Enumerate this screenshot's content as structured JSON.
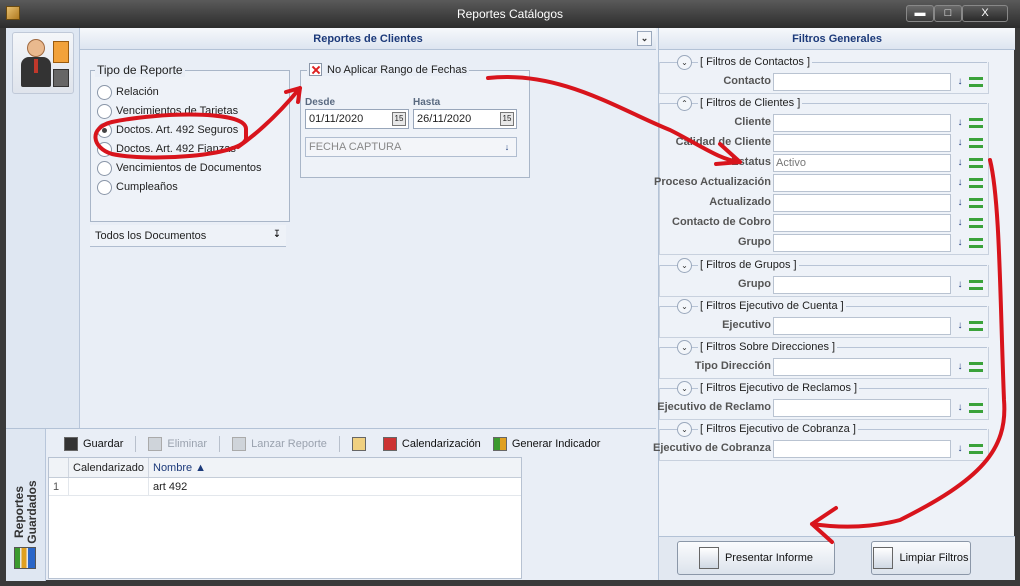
{
  "window": {
    "title": "Reportes Catálogos",
    "min_glyph": "▬",
    "max_glyph": "□",
    "close_glyph": "X"
  },
  "center": {
    "title": "Reportes de Clientes",
    "collapse_glyph": "⌄"
  },
  "tipo_reporte": {
    "legend": "Tipo de Reporte",
    "options": [
      "Relación",
      "Vencimientos de Tarjetas",
      "Doctos. Art. 492 Seguros",
      "Doctos. Art. 492 Fianzas",
      "Vencimientos de Documentos",
      "Cumpleaños"
    ],
    "selected_index": 2
  },
  "docs_select": {
    "value": "Todos los Documentos",
    "icon": "arrow-down-icon"
  },
  "rango": {
    "checkbox_label": "No Aplicar Rango de Fechas",
    "desde_label": "Desde",
    "hasta_label": "Hasta",
    "desde_value": "01/11/2020",
    "hasta_value": "26/11/2020",
    "fecha_tipo": "FECHA CAPTURA",
    "calendar_glyph": "15"
  },
  "saved": {
    "tab_label": "Reportes Guardados",
    "toolbar": {
      "guardar": "Guardar",
      "eliminar": "Eliminar",
      "lanzar": "Lanzar Reporte",
      "calendarizacion": "Calendarización",
      "generar": "Generar Indicador"
    },
    "columns": [
      "Calendarizado",
      "Nombre ▲"
    ],
    "rows": [
      {
        "index": "1",
        "calendarizado": "",
        "nombre": "art 492"
      }
    ]
  },
  "filtros": {
    "title": "Filtros Generales",
    "expand_glyph": "⌄",
    "collapse_glyph": "⌃",
    "down_glyph": "↓",
    "groups": {
      "contactos": {
        "title": "[ Filtros de Contactos ]",
        "fields": [
          "Contacto"
        ]
      },
      "clientes": {
        "title": "[ Filtros de Clientes ]",
        "fields": [
          "Cliente",
          "Calidad de Cliente",
          "Estatus",
          "Proceso Actualización",
          "Actualizado",
          "Contacto de Cobro",
          "Grupo"
        ],
        "estatus_value": "Activo"
      },
      "grupos": {
        "title": "[ Filtros de Grupos ]",
        "fields": [
          "Grupo"
        ]
      },
      "ejecutivo_cuenta": {
        "title": "[ Filtros Ejecutivo de Cuenta ]",
        "fields": [
          "Ejecutivo"
        ]
      },
      "direcciones": {
        "title": "[ Filtros Sobre Direcciones ]",
        "fields": [
          "Tipo Dirección"
        ]
      },
      "ejecutivo_reclamos": {
        "title": "[ Filtros Ejecutivo de Reclamos ]",
        "fields": [
          "Ejecutivo de Reclamo"
        ]
      },
      "ejecutivo_cobranza": {
        "title": "[ Filtros Ejecutivo de Cobranza ]",
        "fields": [
          "Ejecutivo de Cobranza"
        ]
      }
    },
    "presentar": "Presentar Informe",
    "limpiar": "Limpiar Filtros"
  },
  "colors": {
    "accent": "#1c3a7a",
    "annotation": "#d8141c",
    "green": "#3aa23a"
  }
}
